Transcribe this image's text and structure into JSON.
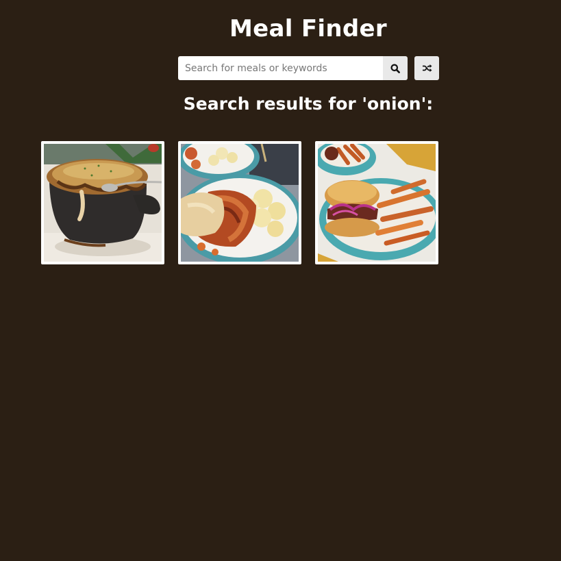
{
  "header": {
    "title": "Meal Finder"
  },
  "search": {
    "placeholder": "Search for meals or keywords",
    "value": "",
    "search_icon": "search-icon",
    "random_icon": "shuffle-icon"
  },
  "results": {
    "heading": "Search results for 'onion':",
    "meals": [
      {
        "image": "french-onion-soup-photo"
      },
      {
        "image": "chicken-onions-potato-salad-photo"
      },
      {
        "image": "burger-onions-sweet-potato-fries-photo"
      }
    ]
  }
}
